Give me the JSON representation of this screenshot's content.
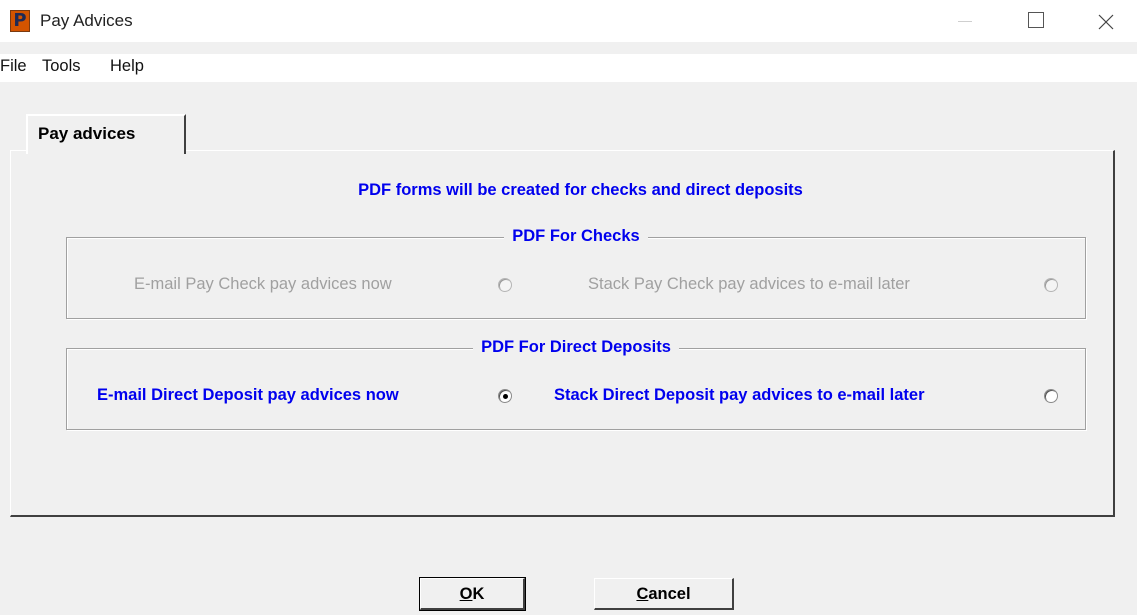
{
  "window": {
    "icon_letter": "P",
    "title": "Pay Advices"
  },
  "menu": [
    "File",
    "Tools",
    "Help"
  ],
  "tab": {
    "label": "Pay advices"
  },
  "headline": "PDF forms will be created for checks and direct deposits",
  "checks_group": {
    "title": "PDF For Checks",
    "options": [
      {
        "label": "E-mail Pay Check pay advices now",
        "selected": false,
        "enabled": false
      },
      {
        "label": "Stack Pay Check pay advices to e-mail later",
        "selected": false,
        "enabled": false
      }
    ]
  },
  "deposits_group": {
    "title": "PDF For Direct Deposits",
    "options": [
      {
        "label": "E-mail Direct Deposit pay advices now",
        "selected": true,
        "enabled": true
      },
      {
        "label": "Stack Direct Deposit pay advices to e-mail later",
        "selected": false,
        "enabled": true
      }
    ]
  },
  "buttons": {
    "ok": {
      "mnemonic": "O",
      "rest": "K"
    },
    "cancel": {
      "mnemonic": "C",
      "rest": "ancel"
    }
  },
  "colors": {
    "accent_text": "#0000ee",
    "disabled_text": "#a0a0a0",
    "dialog_bg": "#f0f0f0",
    "app_icon": "#d35400"
  }
}
